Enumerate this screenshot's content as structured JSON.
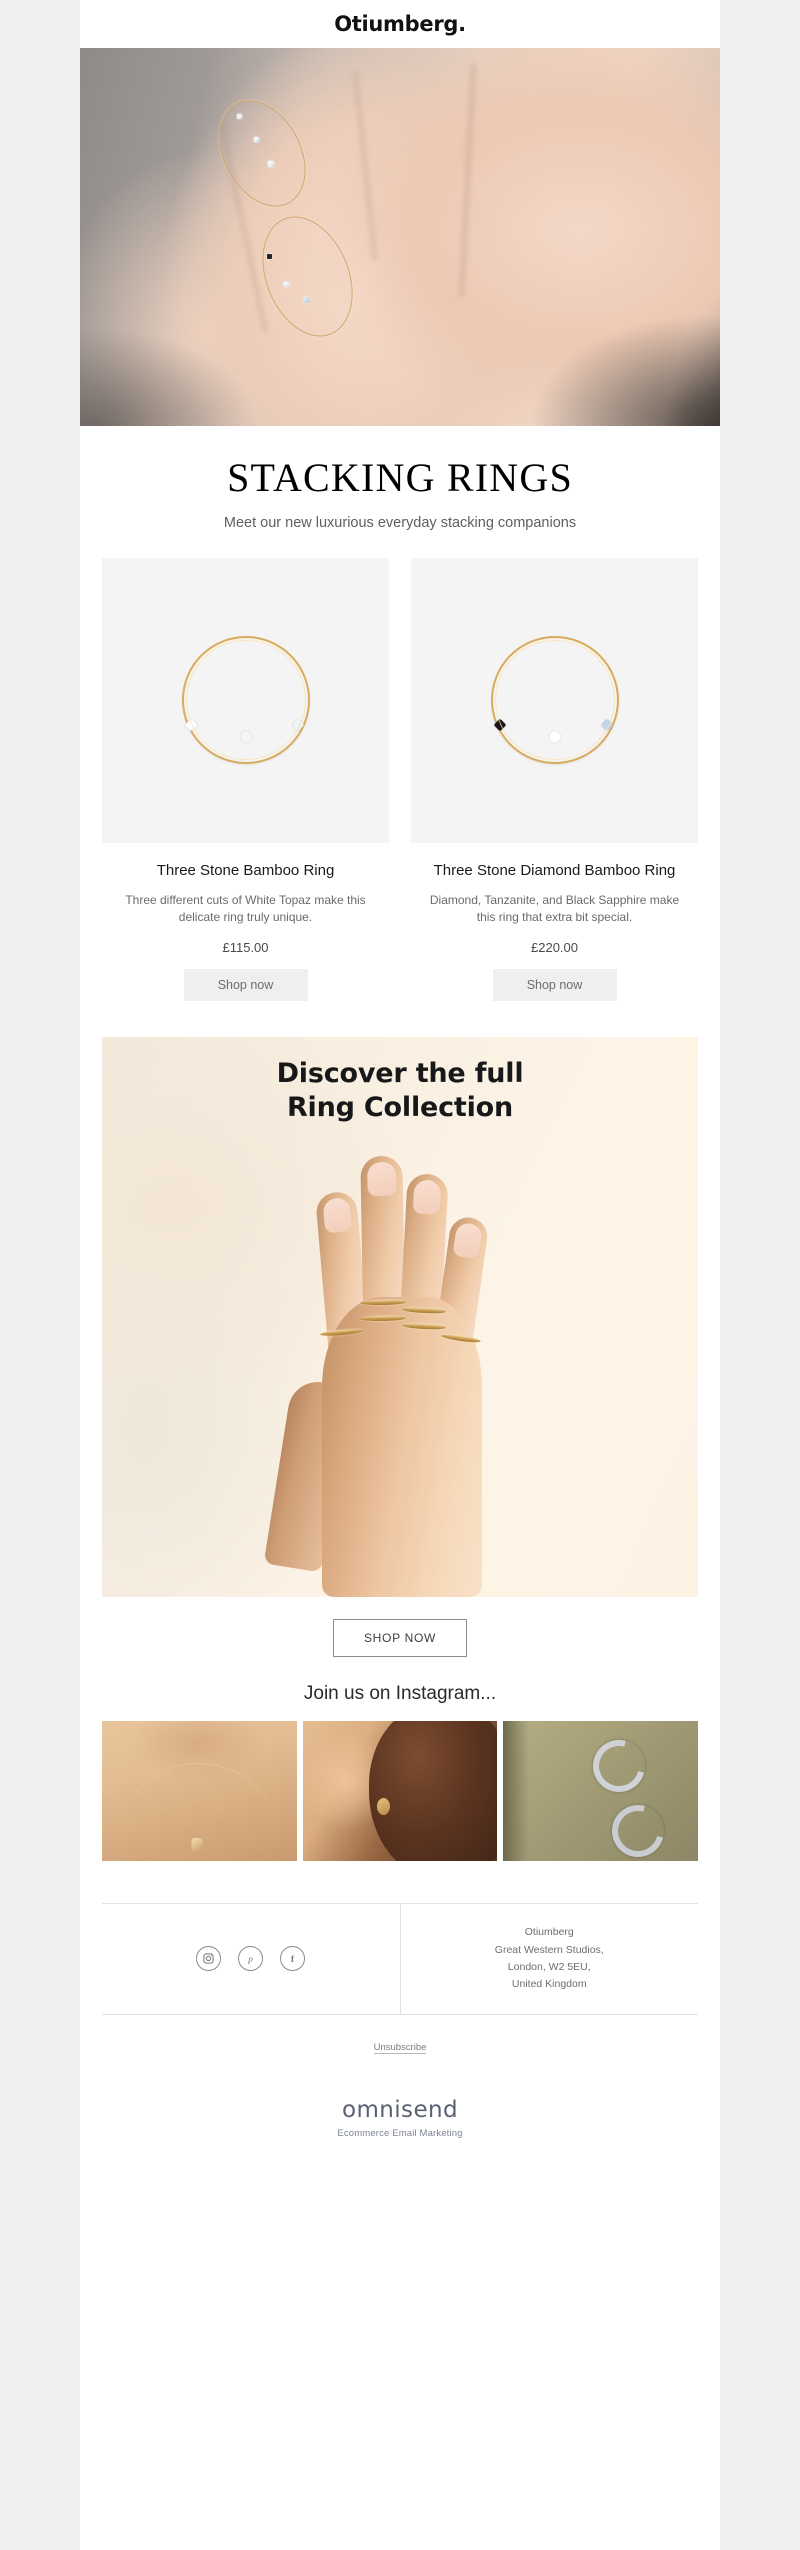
{
  "brand": {
    "logo": "Otiumberg."
  },
  "hero": {
    "alt": "hand-with-stacking-rings-photo"
  },
  "title_block": {
    "heading": "STACKING RINGS",
    "subtitle": "Meet our new luxurious everyday stacking companions"
  },
  "products": [
    {
      "name": "Three Stone Bamboo Ring",
      "description": "Three different cuts of White Topaz make this delicate ring truly unique.",
      "price": "£115.00",
      "button": "Shop now",
      "stones": [
        "#ffffff",
        "#f4f7f9",
        "#eef3f6"
      ]
    },
    {
      "name": "Three Stone Diamond Bamboo Ring",
      "description": "Diamond, Tanzanite, and Black Sapphire make this ring that extra bit special.",
      "price": "£220.00",
      "button": "Shop now",
      "stones": [
        "#17171a",
        "#ffffff",
        "#c3d4e8"
      ]
    }
  ],
  "collection": {
    "title_line1": "Discover the full",
    "title_line2": "Ring Collection",
    "cta": "SHOP NOW"
  },
  "instagram": {
    "heading": "Join us on Instagram...",
    "photos": [
      {
        "alt": "necklace-on-collarbone-photo"
      },
      {
        "alt": "woman-with-hoop-earring-photo"
      },
      {
        "alt": "silver-hoop-earrings-on-fabric-photo"
      }
    ]
  },
  "footer": {
    "social": [
      {
        "name": "instagram",
        "label": "Instagram"
      },
      {
        "name": "pinterest",
        "label": "Pinterest"
      },
      {
        "name": "facebook",
        "label": "Facebook"
      }
    ],
    "address": [
      "Otiumberg",
      "Great Western Studios,",
      "London, W2 5EU,",
      "United Kingdom"
    ],
    "unsubscribe": "Unsubscribe",
    "provider_name": "omnisend",
    "provider_tagline": "Ecommerce Email Marketing"
  },
  "colors": {
    "page_bg": "#f0f0f0",
    "email_bg": "#ffffff",
    "text": "#1a1a1a",
    "muted": "#6a6a6a",
    "button_bg": "#efefef",
    "gold": "#d8ab5e",
    "banner_bg": "#fdf4e7",
    "provider": "#5a6172"
  }
}
